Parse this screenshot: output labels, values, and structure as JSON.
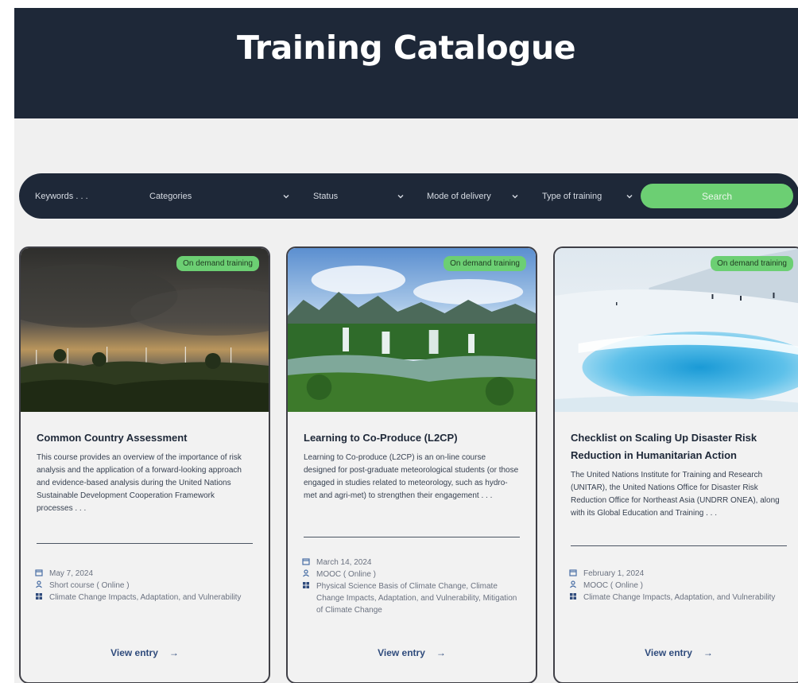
{
  "header": {
    "title": "Training Catalogue"
  },
  "filters": {
    "keywords_placeholder": "Keywords . . .",
    "categories": "Categories",
    "status": "Status",
    "mode": "Mode of delivery",
    "type": "Type of training",
    "search_label": "Search"
  },
  "cards": [
    {
      "badge": "On demand training",
      "title": "Common Country Assessment",
      "description": "This course provides an overview of the importance of risk analysis and the application of a forward-looking approach and evidence-based analysis during the United Nations Sustainable Development Cooperation Framework processes . . .",
      "date": "May 7, 2024",
      "mode": "Short course ( Online )",
      "categories": "Climate Change Impacts, Adaptation, and Vulnerability",
      "cta": "View entry",
      "arrow": "→"
    },
    {
      "badge": "On demand training",
      "title": "Learning to Co-Produce (L2CP)",
      "description": "Learning to Co-produce (L2CP) is an on-line course designed for post-graduate meteorological students (or those engaged in studies related to meteorology, such as hydro-met and agri-met) to strengthen their engagement . . .",
      "date": "March 14, 2024",
      "mode": "MOOC ( Online )",
      "categories": "Physical Science Basis of Climate Change, Climate Change Impacts, Adaptation, and Vulnerability, Mitigation of Climate Change",
      "cta": "View entry",
      "arrow": "→"
    },
    {
      "badge": "On demand training",
      "title": "Checklist on Scaling Up Disaster Risk Reduction in Humanitarian Action",
      "description": "The United Nations Institute for Training and Research (UNITAR), the United Nations Office for Disaster Risk Reduction Office for Northeast Asia (UNDRR ONEA), along with its Global Education and Training . . .",
      "date": "February 1, 2024",
      "mode": "MOOC ( Online )",
      "categories": "Climate Change Impacts, Adaptation, and Vulnerability",
      "cta": "View entry",
      "arrow": "→"
    }
  ],
  "colors": {
    "navy": "#1e2838",
    "green": "#6ccf73",
    "link": "#2f4b7c",
    "page_bg": "#f0f0f0"
  }
}
